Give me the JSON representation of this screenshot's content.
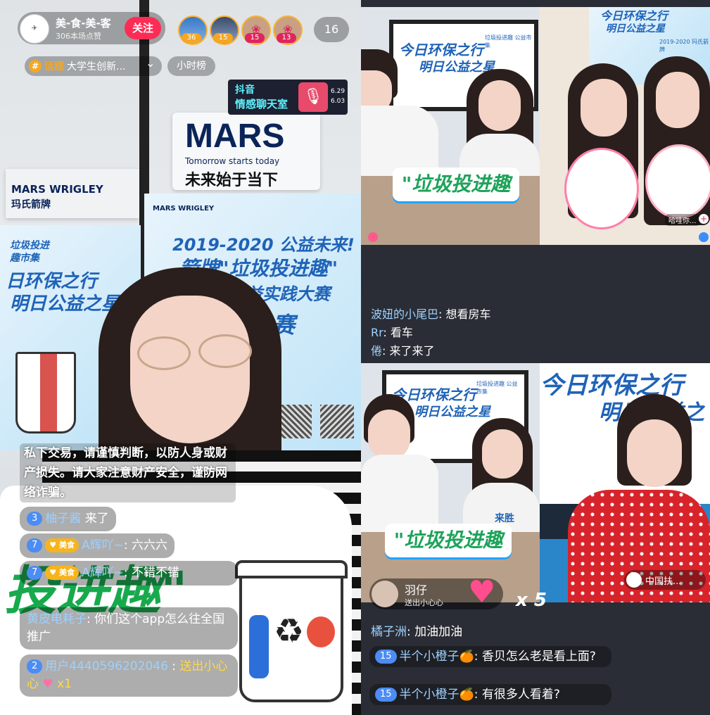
{
  "streamer": {
    "name": "美-食-美-客",
    "likes": "306本场点赞",
    "follow_label": "关注",
    "viewers_total": "16",
    "viewer_badges": [
      "36",
      "15",
      "15",
      "13"
    ]
  },
  "topic": {
    "icon_label": "#",
    "prefix": "话题",
    "name": "大学生创新...",
    "chevron": "⌄",
    "rank_label": "小时榜"
  },
  "sticker": {
    "line1": "抖音",
    "line2": "情感聊天室",
    "date1": "6.29",
    "date2": "6.03"
  },
  "posters": {
    "mars_title": "MARS",
    "mars_sub": "Tomorrow starts today",
    "mars_cn": "未来始于当下",
    "mars_wrigley": "MARS WRIGLEY",
    "wrigley_cn": "玛氏箭牌",
    "mars_wrigley_small": "MARS WRIGLEY",
    "wrigley_cn_small": "玛氏箭牌",
    "board_year": "2019-2020 公益未来!",
    "board_line2": "箭牌\"垃圾投进趣\"",
    "board_line3": "公益实践大赛",
    "board_line4": "决赛",
    "left_side1": "垃圾投进",
    "left_side2": "趣市集",
    "left_poster1": "日环保之行",
    "left_poster2": "明日公益之星",
    "hold_sign": "投进趣\""
  },
  "left_chat": [
    {
      "type": "notice",
      "text": "私下交易，请谨慎判断，以防人身或财产损失。请大家注意财产安全，谨防网络诈骗。"
    },
    {
      "type": "enter",
      "level": "3",
      "name": "柚子酱",
      "text": "来了"
    },
    {
      "type": "msg",
      "level": "7",
      "badge": "美食",
      "name": "A辉吖~",
      "text": "六六六"
    },
    {
      "type": "msg",
      "level": "7",
      "badge": "美食",
      "name": "A辉吖~",
      "text": "不错不错"
    },
    {
      "type": "plain",
      "name": "黄皮电耗子",
      "text": "你们这个app怎么往全国推广"
    },
    {
      "type": "gift",
      "level": "2",
      "name": "用户4440596202046",
      "text": "送出小心心",
      "count": "x1"
    }
  ],
  "right_top_tiles": {
    "tile1_board1": "今日环保之行",
    "tile1_board2": "明日公益之星",
    "tile1_board_small": "垃圾投进趣 公益市集",
    "tile1_sign": "\"垃圾投进趣",
    "tile2_board1": "今日环保之行",
    "tile2_board2": "明日公益之星",
    "tile2_board_small": "2019-2020 玛氏箭牌",
    "tile2_user": "哈哇你..."
  },
  "right_mid_chat": [
    {
      "name": "波妞的小尾巴",
      "text": "想看房车"
    },
    {
      "name": "Rr",
      "text": "看车"
    },
    {
      "name": "倦",
      "text": "来了来了"
    }
  ],
  "right_bottom_tiles": {
    "tile3_board1": "今日环保之行",
    "tile3_board_small": "垃圾投进趣 公益市集",
    "tile3_board2": "明日公益之星",
    "tile3_sign": "\"垃圾投进趣",
    "tile3_sign_small": "来胜",
    "tile4_board1": "今日环保之行",
    "tile4_board2": "明日公益之",
    "tile4_name": "中国扶..."
  },
  "gift_popup": {
    "name": "羽仔",
    "action": "送出小心心",
    "count": "x 5"
  },
  "right_bottom_chat": [
    {
      "type": "plain",
      "name": "橘子洲",
      "text": "加油加油"
    },
    {
      "type": "msg",
      "level": "15",
      "name": "半个小橙子🍊",
      "text": "香贝怎么老是看上面?"
    },
    {
      "type": "msg",
      "level": "15",
      "name": "半个小橙子🍊",
      "text": "有很多人看着?"
    }
  ],
  "colors": {
    "follow_bg": "#fe2c55",
    "level_blue": "#4c8cf5",
    "name_blue": "#9ed0ff",
    "name_yellow": "#ffd84a",
    "green_text": "#1da35a"
  }
}
